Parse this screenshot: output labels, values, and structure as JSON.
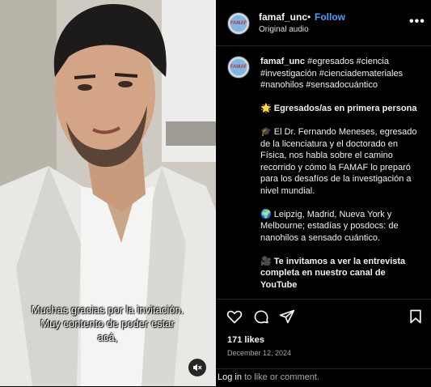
{
  "video": {
    "subtitle_line1": "Muchas gracias por la invitación.",
    "subtitle_line2": "Muy contento de poder estar",
    "subtitle_line3": "acá,"
  },
  "header": {
    "username": "famaf_unc",
    "separator": "•",
    "follow_label": "Follow",
    "audio_label": "Original audio",
    "more_label": "•••",
    "avatar_text": "FAMAF"
  },
  "caption": {
    "username": "famaf_unc",
    "hashtags": "#egresados #ciencia #investigación #cienciademateriales #nanohilos #sensadocuántico",
    "para1": "🌟 Egresados/as en primera persona",
    "para2": "🎓 El Dr. Fernando Meneses, egresado de la licenciatura y el doctorado en Física, nos habla sobre el camino recorrido y cómo la FAMAF lo preparó para los desafíos de la investigación a nivel mundial.",
    "para3": "🌍 Leipzig, Madrid, Nueva York y Melbourne; estadías y posdocs: de nanohilos a sensado cuántico.",
    "para4": "🎥 Te invitamos a ver la entrevista completa en nuestro canal de YouTube"
  },
  "actions": {
    "likes": "171 likes",
    "date": "December 12, 2024"
  },
  "login": {
    "link_label": "Log in",
    "rest": " to like or comment."
  },
  "colors": {
    "background": "#000000",
    "follow": "#4d9fff",
    "divider": "#262626",
    "muted_text": "#a8a8a8"
  }
}
